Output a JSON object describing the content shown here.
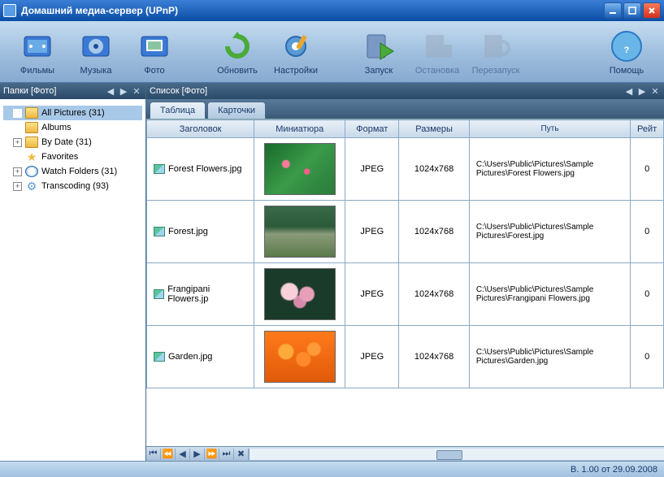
{
  "window": {
    "title": "Домашний медиа-сервер (UPnP)"
  },
  "toolbar": {
    "films": "Фильмы",
    "music": "Музыка",
    "photo": "Фото",
    "refresh": "Обновить",
    "settings": "Настройки",
    "start": "Запуск",
    "stop": "Остановка",
    "restart": "Перезапуск",
    "help": "Помощь"
  },
  "panels": {
    "folders_title": "Папки [Фото]",
    "list_title": "Список [Фото]"
  },
  "tabs": {
    "table": "Таблица",
    "cards": "Карточки"
  },
  "tree": [
    {
      "label": "All Pictures (31)",
      "icon": "folder",
      "expand": "",
      "selected": true
    },
    {
      "label": "Albums",
      "icon": "folder",
      "expand": ""
    },
    {
      "label": "By Date (31)",
      "icon": "folder",
      "expand": "+"
    },
    {
      "label": "Favorites",
      "icon": "star",
      "expand": ""
    },
    {
      "label": "Watch Folders (31)",
      "icon": "clock",
      "expand": "+"
    },
    {
      "label": "Transcoding (93)",
      "icon": "gear",
      "expand": "+"
    }
  ],
  "columns": {
    "title": "Заголовок",
    "thumb": "Миниатюра",
    "format": "Формат",
    "size": "Размеры",
    "path": "Путь",
    "rating": "Рейт"
  },
  "rows": [
    {
      "title": "Forest Flowers.jpg",
      "format": "JPEG",
      "size": "1024x768",
      "path": "C:\\Users\\Public\\Pictures\\Sample Pictures\\Forest Flowers.jpg",
      "rating": "0",
      "thumb": "green-flowers"
    },
    {
      "title": "Forest.jpg",
      "format": "JPEG",
      "size": "1024x768",
      "path": "C:\\Users\\Public\\Pictures\\Sample Pictures\\Forest.jpg",
      "rating": "0",
      "thumb": "forest-path"
    },
    {
      "title": "Frangipani Flowers.jp",
      "format": "JPEG",
      "size": "1024x768",
      "path": "C:\\Users\\Public\\Pictures\\Sample Pictures\\Frangipani Flowers.jpg",
      "rating": "0",
      "thumb": "pink-flowers"
    },
    {
      "title": "Garden.jpg",
      "format": "JPEG",
      "size": "1024x768",
      "path": "C:\\Users\\Public\\Pictures\\Sample Pictures\\Garden.jpg",
      "rating": "0",
      "thumb": "orange-flowers"
    }
  ],
  "thumb_styles": {
    "green-flowers": "background: radial-gradient(circle at 30% 40%, #ff7a9a 6%, transparent 8%), radial-gradient(circle at 60% 55%, #ff5a8a 5%, transparent 7%), linear-gradient(135deg, #1a6a2a, #3a9a4a, #2a7a3a);",
    "forest-path": "background: linear-gradient(to bottom, #3a6a4a 0%, #2a5a3a 40%, #8a9a7a 55%, #5a7a4a 100%);",
    "pink-flowers": "background: radial-gradient(circle at 35% 45%, #f8d0da 15%, transparent 18%), radial-gradient(circle at 60% 50%, #e8a0ba 14%, transparent 17%), radial-gradient(circle at 50% 65%, #d88aaa 12%, transparent 15%), #1a3a2a;",
    "orange-flowers": "background: radial-gradient(circle at 30% 40%, #ffaa3a 12%, transparent 15%), radial-gradient(circle at 55% 55%, #ff8a2a 14%, transparent 17%), radial-gradient(circle at 70% 35%, #ff9a3a 10%, transparent 13%), linear-gradient(to bottom, #ff7a1a, #e05a0a);"
  },
  "status": {
    "version": "В. 1.00 от 29.09.2008"
  }
}
